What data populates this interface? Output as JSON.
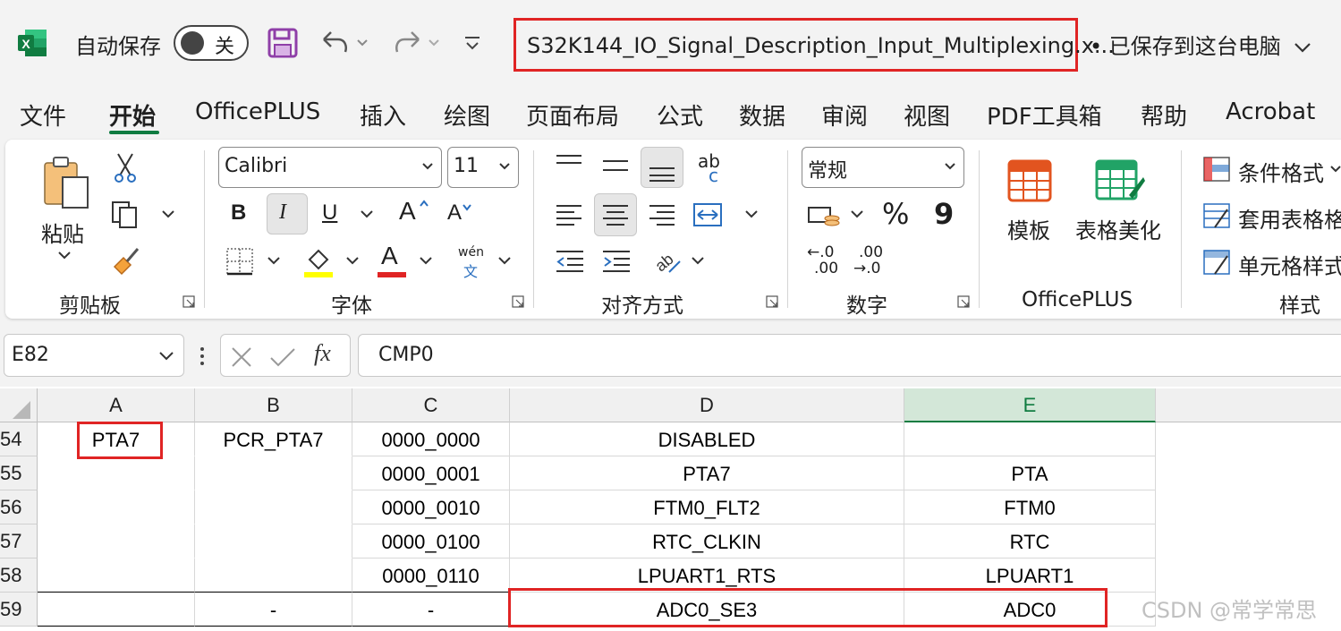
{
  "titlebar": {
    "autosave_label": "自动保存",
    "autosave_state": "关",
    "document_title": "S32K144_IO_Signal_Description_Input_Multiplexing.x...",
    "save_status": "• 已保存到这台电脑"
  },
  "tabs": [
    "文件",
    "开始",
    "OfficePLUS",
    "插入",
    "绘图",
    "页面布局",
    "公式",
    "数据",
    "审阅",
    "视图",
    "PDF工具箱",
    "帮助",
    "Acrobat"
  ],
  "active_tab": "开始",
  "ribbon": {
    "clipboard": {
      "paste_label": "粘贴",
      "group_label": "剪贴板"
    },
    "font": {
      "font_name": "Calibri",
      "font_size": "11",
      "group_label": "字体",
      "bold": "B",
      "italic": "I",
      "underline": "U",
      "grow": "A",
      "shrink": "A",
      "font_color_letter": "A",
      "phonetic_top": "wén",
      "phonetic_bottom": "文"
    },
    "alignment": {
      "group_label": "对齐方式",
      "wrap_top": "ab",
      "wrap_bottom": "c"
    },
    "number": {
      "format": "常规",
      "group_label": "数字",
      "percent": "%",
      "comma": "9",
      "inc_top": "←.0",
      "inc_bottom": ".00",
      "dec_top": ".00",
      "dec_bottom": "→.0"
    },
    "officeplus": {
      "template_label": "模板",
      "beautify_label": "表格美化",
      "group_label": "OfficePLUS"
    },
    "styles": {
      "conditional": "条件格式",
      "table_format": "套用表格格",
      "cell_style": "单元格样式",
      "group_label": "样式"
    }
  },
  "formula_bar": {
    "name_box": "E82",
    "fx": "fx",
    "formula": "CMP0"
  },
  "sheet": {
    "columns": [
      "A",
      "B",
      "C",
      "D",
      "E"
    ],
    "selected_column": "E",
    "rows": [
      {
        "num": "54",
        "a": "PTA7",
        "b": "PCR_PTA7",
        "c": "0000_0000",
        "d": "DISABLED",
        "e": ""
      },
      {
        "num": "55",
        "a": "",
        "b": "",
        "c": "0000_0001",
        "d": "PTA7",
        "e": "PTA"
      },
      {
        "num": "56",
        "a": "",
        "b": "",
        "c": "0000_0010",
        "d": "FTM0_FLT2",
        "e": "FTM0"
      },
      {
        "num": "57",
        "a": "",
        "b": "",
        "c": "0000_0100",
        "d": "RTC_CLKIN",
        "e": "RTC"
      },
      {
        "num": "58",
        "a": "",
        "b": "",
        "c": "0000_0110",
        "d": "LPUART1_RTS",
        "e": "LPUART1"
      },
      {
        "num": "59",
        "a": "",
        "b": "-",
        "c": "-",
        "d": "ADC0_SE3",
        "e": "ADC0"
      }
    ]
  },
  "watermark": "CSDN @常学常思",
  "colors": {
    "excel_green": "#107c41",
    "highlight_red": "#e02424",
    "save_purple": "#8f3fa8"
  }
}
